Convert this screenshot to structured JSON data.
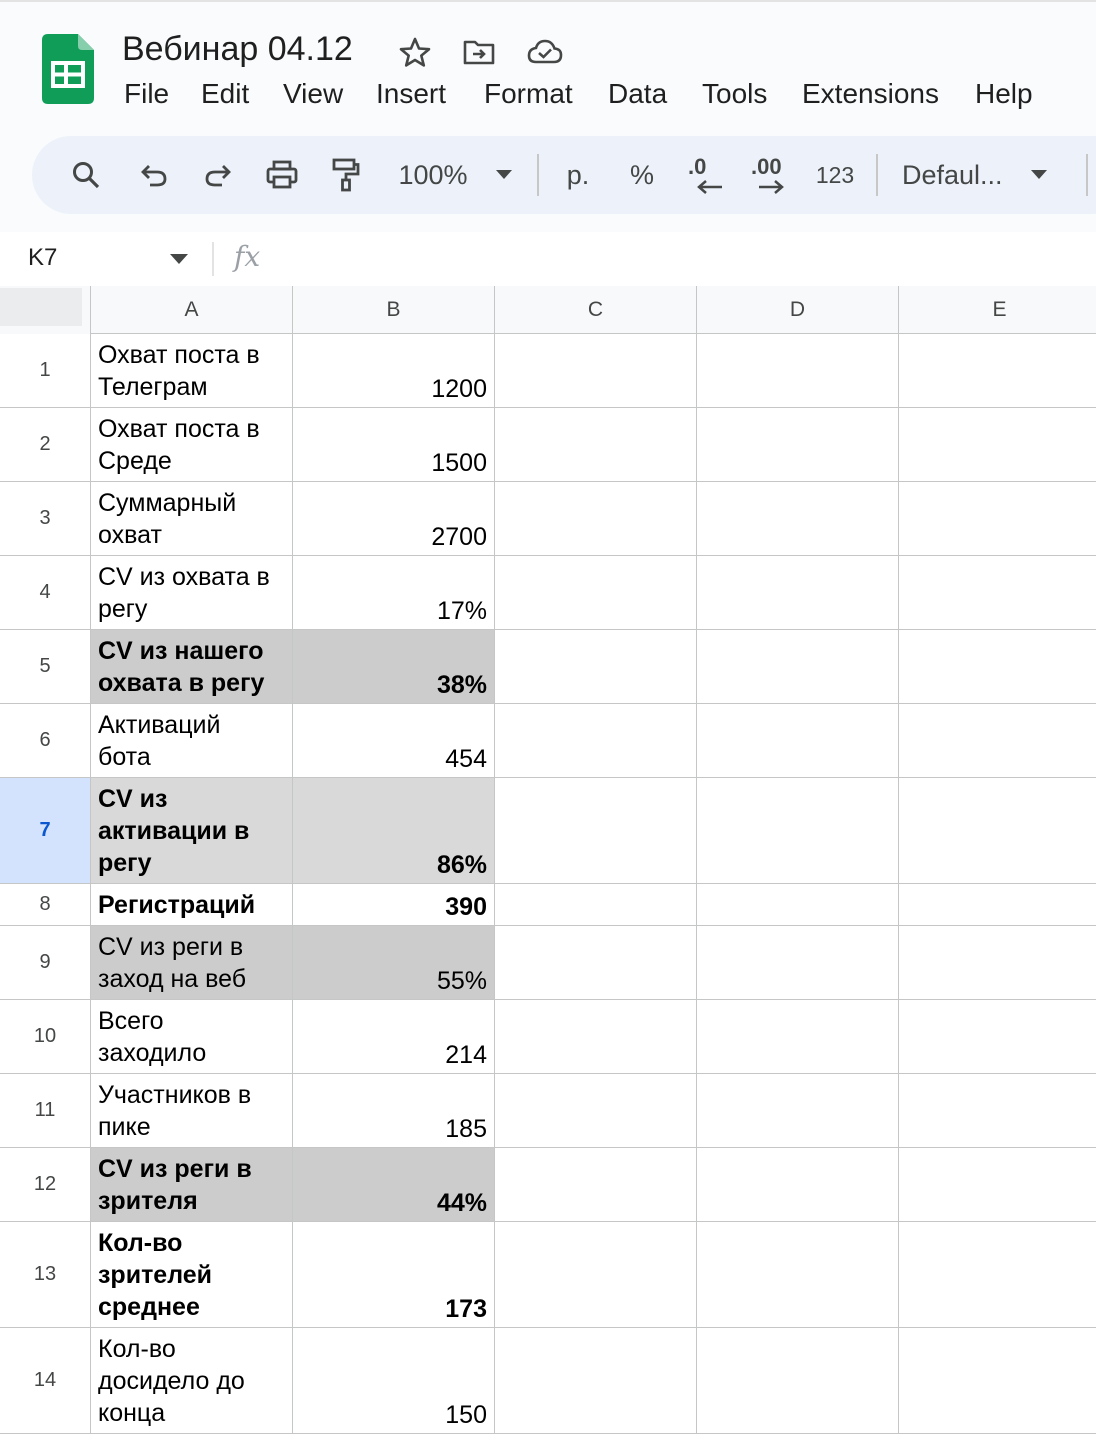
{
  "app": {
    "title": "Вебинар 04.12",
    "menu": [
      "File",
      "Edit",
      "View",
      "Insert",
      "Format",
      "Data",
      "Tools",
      "Extensions",
      "Help"
    ]
  },
  "toolbar": {
    "zoom": "100%",
    "currency": "р.",
    "percent": "%",
    "decrease_decimals": ".0",
    "increase_decimals": ".00",
    "more_formats": "123",
    "font": "Defaul..."
  },
  "formula_bar": {
    "name_box": "K7",
    "fx": "fx",
    "value": ""
  },
  "columns": [
    "A",
    "B",
    "C",
    "D",
    "E"
  ],
  "rows": [
    {
      "num": "1",
      "label": "Охват поста в\nТелеграм",
      "value": "1200",
      "style": "normal"
    },
    {
      "num": "2",
      "label": "Охват поста в\nСреде",
      "value": "1500",
      "style": "normal"
    },
    {
      "num": "3",
      "label": "Суммарный\nохват",
      "value": "2700",
      "style": "normal"
    },
    {
      "num": "4",
      "label": "CV из охвата в\nрегу",
      "value": "17%",
      "style": "normal"
    },
    {
      "num": "5",
      "label": "CV из нашего\nохвата в регу",
      "value": "38%",
      "style": "bold-gray"
    },
    {
      "num": "6",
      "label": "Активаций\nбота",
      "value": "454",
      "style": "normal"
    },
    {
      "num": "7",
      "label": "CV из\nактивации в\nрегу",
      "value": "86%",
      "style": "bold-lightgray"
    },
    {
      "num": "8",
      "label": "Регистраций",
      "value": "390",
      "style": "bold"
    },
    {
      "num": "9",
      "label": "CV из реги в\nзаход на веб",
      "value": "55%",
      "style": "gray"
    },
    {
      "num": "10",
      "label": "Всего\nзаходило",
      "value": "214",
      "style": "normal"
    },
    {
      "num": "11",
      "label": "Участников в\nпике",
      "value": "185",
      "style": "normal"
    },
    {
      "num": "12",
      "label": "CV из реги в\nзрителя",
      "value": "44%",
      "style": "bold-gray"
    },
    {
      "num": "13",
      "label": "Кол-во\nзрителей\nсреднее",
      "value": "173",
      "style": "bold"
    },
    {
      "num": "14",
      "label": "Кол-во\nдосидело до\nконца",
      "value": "150",
      "style": "normal"
    }
  ],
  "selected_row": "7",
  "colors": {
    "sheets_green": "#0f9d58",
    "selection_blue": "#d3e3fd",
    "header_gray": "#f8f9fa",
    "cell_gray": "#cccccc",
    "cell_light_gray": "#d9d9d9"
  }
}
